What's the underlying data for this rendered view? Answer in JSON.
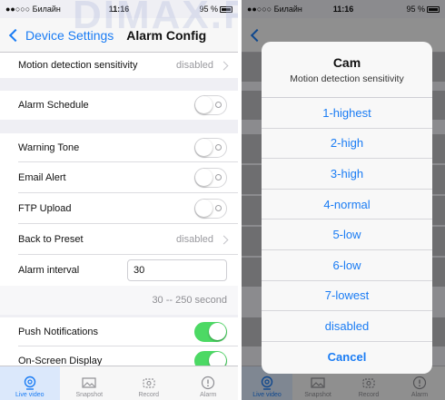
{
  "left": {
    "status": {
      "carrier": "●●○○○ Билайн",
      "time": "11:16",
      "battery": "95 %"
    },
    "nav": {
      "back_label": "Device Settings",
      "title": "Alarm Config"
    },
    "rows": {
      "motion_label": "Motion detection sensitivity",
      "motion_value": "disabled",
      "schedule_label": "Alarm Schedule",
      "warning_label": "Warning Tone",
      "email_label": "Email Alert",
      "ftp_label": "FTP Upload",
      "preset_label": "Back to Preset",
      "preset_value": "disabled",
      "interval_label": "Alarm interval",
      "interval_value": "30",
      "interval_range": "30 -- 250 second",
      "push_label": "Push Notifications",
      "osd_label": "On-Screen Display"
    },
    "toggles": {
      "schedule": false,
      "warning": false,
      "email": false,
      "ftp": false,
      "push": true,
      "osd": true
    },
    "tabs": [
      {
        "label": "Live video",
        "icon": "camera-icon"
      },
      {
        "label": "Snapshot",
        "icon": "image-icon"
      },
      {
        "label": "Record",
        "icon": "video-record-icon"
      },
      {
        "label": "Alarm",
        "icon": "alarm-icon"
      }
    ]
  },
  "watermark": "DIMAX.RU",
  "right": {
    "status": {
      "carrier": "●●○○○ Билайн",
      "time": "11:16",
      "battery": "95 %"
    },
    "sheet": {
      "title": "Cam",
      "subtitle": "Motion detection sensitivity",
      "options": [
        "1-highest",
        "2-high",
        "3-high",
        "4-normal",
        "5-low",
        "6-low",
        "7-lowest",
        "disabled"
      ],
      "cancel": "Cancel"
    },
    "tabs": [
      {
        "label": "Live video"
      },
      {
        "label": "Snapshot"
      },
      {
        "label": "Record"
      },
      {
        "label": "Alarm"
      }
    ]
  },
  "colors": {
    "accent": "#1a7cf4",
    "toggle_on": "#4cd964",
    "background": "#efeff4"
  }
}
